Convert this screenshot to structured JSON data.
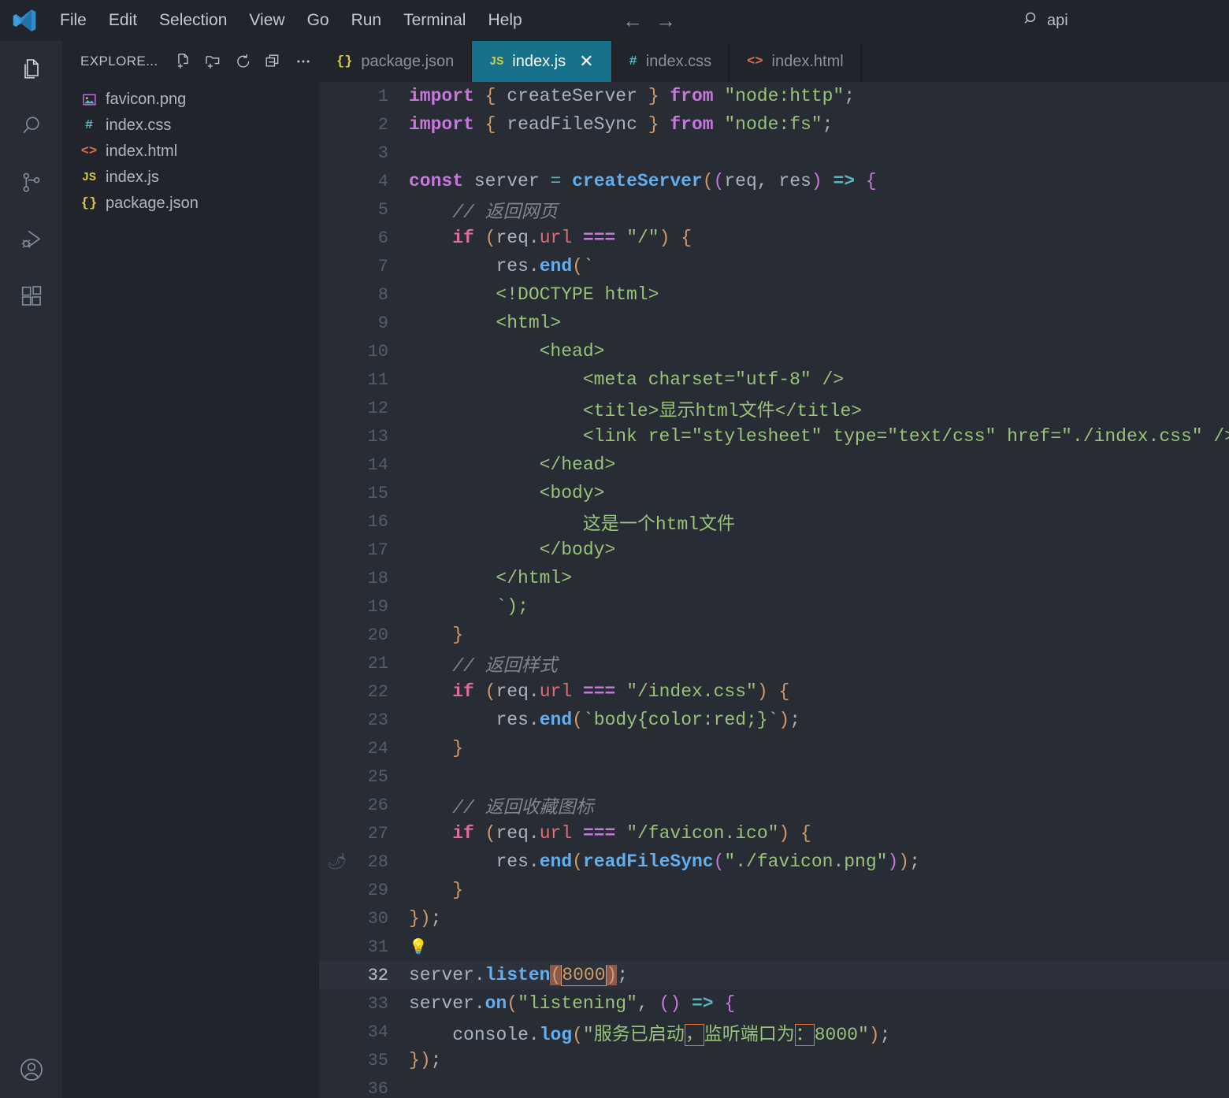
{
  "titlebar": {
    "logo_icon": "vscode-logo-icon",
    "menus": [
      "File",
      "Edit",
      "Selection",
      "View",
      "Go",
      "Run",
      "Terminal",
      "Help"
    ],
    "back_icon": "arrow-left-icon",
    "forward_icon": "arrow-right-icon",
    "search_icon": "search-icon",
    "search_value": "api"
  },
  "activitybar": {
    "items": [
      {
        "name": "explorer",
        "icon": "files-icon",
        "active": true
      },
      {
        "name": "search",
        "icon": "search-icon",
        "active": false
      },
      {
        "name": "source-control",
        "icon": "source-control-icon",
        "active": false
      },
      {
        "name": "run-and-debug",
        "icon": "run-debug-icon",
        "active": false
      },
      {
        "name": "extensions",
        "icon": "extensions-icon",
        "active": false
      }
    ],
    "account_icon": "account-icon"
  },
  "sidebar": {
    "title": "EXPLORE...",
    "actions": [
      {
        "name": "new-file",
        "icon": "new-file-icon"
      },
      {
        "name": "new-folder",
        "icon": "new-folder-icon"
      },
      {
        "name": "refresh",
        "icon": "refresh-icon"
      },
      {
        "name": "collapse-all",
        "icon": "collapse-all-icon"
      },
      {
        "name": "more-actions",
        "icon": "ellipsis-icon"
      }
    ],
    "files": [
      {
        "name": "favicon.png",
        "icon": "image-file-icon",
        "icon_glyph": "❑",
        "icon_color": "#c678dd"
      },
      {
        "name": "index.css",
        "icon": "css-file-icon",
        "icon_glyph": "#",
        "icon_color": "#56b6c2"
      },
      {
        "name": "index.html",
        "icon": "html-file-icon",
        "icon_glyph": "<>",
        "icon_color": "#e06c4a"
      },
      {
        "name": "index.js",
        "icon": "js-file-icon",
        "icon_glyph": "JS",
        "icon_color": "#d5c94a"
      },
      {
        "name": "package.json",
        "icon": "json-file-icon",
        "icon_glyph": "{}",
        "icon_color": "#d5c94a"
      }
    ]
  },
  "tabs": [
    {
      "label": "package.json",
      "icon_glyph": "{}",
      "icon_color": "#d5c94a",
      "active": false,
      "closable": false
    },
    {
      "label": "index.js",
      "icon_glyph": "JS",
      "icon_color": "#d5c94a",
      "active": true,
      "closable": true,
      "close_glyph": "✕"
    },
    {
      "label": "index.css",
      "icon_glyph": "#",
      "icon_color": "#56b6c2",
      "active": false,
      "closable": false
    },
    {
      "label": "index.html",
      "icon_glyph": "<>",
      "icon_color": "#e06c4a",
      "active": false,
      "closable": false
    }
  ],
  "editor": {
    "file": "index.js",
    "active_line": 32,
    "breakpoint_line": 28,
    "breakpoint_glyph": "🌶",
    "lightbulb_line": 31,
    "lightbulb_glyph": "💡",
    "lines": [
      {
        "n": 1,
        "text": "import { createServer } from \"node:http\";"
      },
      {
        "n": 2,
        "text": "import { readFileSync } from \"node:fs\";"
      },
      {
        "n": 3,
        "text": ""
      },
      {
        "n": 4,
        "text": "const server = createServer((req, res) => {"
      },
      {
        "n": 5,
        "text": "    // 返回网页"
      },
      {
        "n": 6,
        "text": "    if (req.url === \"/\") {"
      },
      {
        "n": 7,
        "text": "        res.end(`"
      },
      {
        "n": 8,
        "text": "        <!DOCTYPE html>"
      },
      {
        "n": 9,
        "text": "        <html>"
      },
      {
        "n": 10,
        "text": "            <head>"
      },
      {
        "n": 11,
        "text": "                <meta charset=\"utf-8\" />"
      },
      {
        "n": 12,
        "text": "                <title>显示html文件</title>"
      },
      {
        "n": 13,
        "text": "                <link rel=\"stylesheet\" type=\"text/css\" href=\"./index.css\" />"
      },
      {
        "n": 14,
        "text": "            </head>"
      },
      {
        "n": 15,
        "text": "            <body>"
      },
      {
        "n": 16,
        "text": "                这是一个html文件"
      },
      {
        "n": 17,
        "text": "            </body>"
      },
      {
        "n": 18,
        "text": "        </html>"
      },
      {
        "n": 19,
        "text": "        `);"
      },
      {
        "n": 20,
        "text": "    }"
      },
      {
        "n": 21,
        "text": "    // 返回样式"
      },
      {
        "n": 22,
        "text": "    if (req.url === \"/index.css\") {"
      },
      {
        "n": 23,
        "text": "        res.end(`body{color:red;}`);"
      },
      {
        "n": 24,
        "text": "    }"
      },
      {
        "n": 25,
        "text": ""
      },
      {
        "n": 26,
        "text": "    // 返回收藏图标"
      },
      {
        "n": 27,
        "text": "    if (req.url === \"/favicon.ico\") {"
      },
      {
        "n": 28,
        "text": "        res.end(readFileSync(\"./favicon.png\"));"
      },
      {
        "n": 29,
        "text": "    }"
      },
      {
        "n": 30,
        "text": "});"
      },
      {
        "n": 31,
        "text": ""
      },
      {
        "n": 32,
        "text": "server.listen(8000);"
      },
      {
        "n": 33,
        "text": "server.on(\"listening\", () => {"
      },
      {
        "n": 34,
        "text": "    console.log(\"服务已启动，监听端口为：8000\");"
      },
      {
        "n": 35,
        "text": "});"
      },
      {
        "n": 36,
        "text": ""
      }
    ]
  },
  "colors": {
    "accent_tab": "#17718a",
    "editor_bg": "#282c34",
    "sidebar_bg": "#21252b",
    "string": "#98c379",
    "keyword": "#c678dd",
    "function": "#61afef",
    "number": "#d19a66",
    "comment": "#7f848e",
    "breakpoint": "#e04545",
    "unicode_highlight": "#e8752d"
  }
}
